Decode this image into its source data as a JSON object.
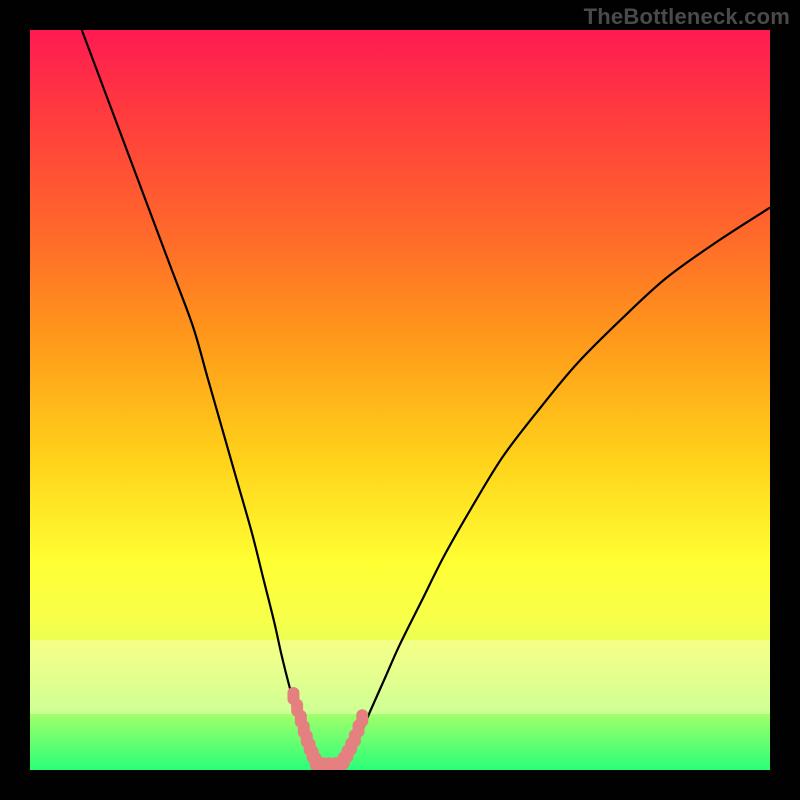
{
  "watermark": "TheBottleneck.com",
  "colors": {
    "background": "#000100",
    "curve": "#000000",
    "marker": "#e48080",
    "gradient_top": "#ff1a52",
    "gradient_bottom": "#2aff78"
  },
  "chart_data": {
    "type": "line",
    "title": "",
    "xlabel": "",
    "ylabel": "",
    "xlim": [
      0,
      100
    ],
    "ylim": [
      0,
      100
    ],
    "grid": false,
    "legend": false,
    "annotations": [],
    "series": [
      {
        "name": "left-curve",
        "x": [
          7,
          10,
          13,
          16,
          19,
          22,
          24,
          26,
          28,
          30,
          31.5,
          33,
          34,
          35,
          36,
          36.8,
          37.5,
          38,
          38.5
        ],
        "y": [
          100,
          92,
          84,
          76,
          68,
          60,
          53,
          46,
          39,
          32,
          26,
          20,
          15.5,
          11.5,
          8,
          5,
          3,
          1.5,
          0.5
        ]
      },
      {
        "name": "right-curve",
        "x": [
          42,
          43,
          44.5,
          46,
          48,
          50,
          53,
          56,
          60,
          64,
          69,
          74,
          80,
          86,
          93,
          100
        ],
        "y": [
          0.5,
          2,
          4.5,
          8,
          12.5,
          17,
          23,
          29,
          36,
          42.5,
          49,
          55,
          61,
          66.5,
          71.5,
          76
        ]
      }
    ],
    "markers": [
      {
        "name": "left-cluster",
        "x": [
          35.6,
          36.1,
          36.6,
          37.0,
          37.4,
          37.8,
          38.2,
          38.6
        ],
        "y": [
          10.0,
          8.4,
          6.9,
          5.5,
          4.2,
          3.1,
          2.1,
          1.2
        ]
      },
      {
        "name": "bottom-cluster",
        "x": [
          38.8,
          39.6,
          40.4,
          41.2,
          42.0
        ],
        "y": [
          0.7,
          0.5,
          0.5,
          0.5,
          0.7
        ]
      },
      {
        "name": "right-cluster",
        "x": [
          42.4,
          42.9,
          43.4,
          43.9,
          44.4,
          44.9
        ],
        "y": [
          1.3,
          2.2,
          3.2,
          4.3,
          5.6,
          7.0
        ]
      }
    ]
  }
}
